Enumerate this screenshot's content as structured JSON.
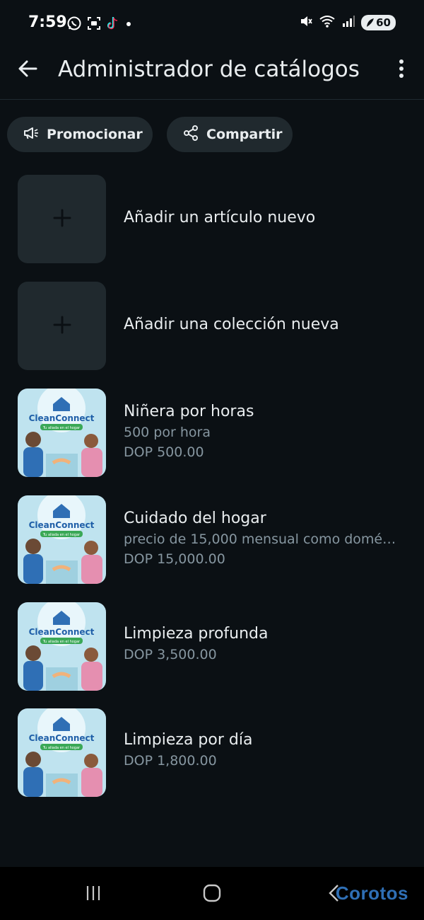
{
  "status_bar": {
    "time": "7:59",
    "battery": "60",
    "icons_left": [
      "whatsapp-icon",
      "scan-icon",
      "tiktok-icon",
      "dot-icon"
    ],
    "icons_right": [
      "mute-icon",
      "wifi-icon",
      "signal-icon",
      "battery-icon"
    ]
  },
  "header": {
    "title": "Administrador de catálogos",
    "back_icon": "arrow-left-icon",
    "menu_icon": "more-vertical-icon"
  },
  "actions": {
    "promote_label": "Promocionar",
    "promote_icon": "megaphone-icon",
    "share_label": "Compartir",
    "share_icon": "share-icon"
  },
  "add_rows": [
    {
      "label": "Añadir un artículo nuevo",
      "icon": "plus-icon"
    },
    {
      "label": "Añadir una colección nueva",
      "icon": "plus-icon"
    }
  ],
  "thumbnail": {
    "brand": "CleanConnect",
    "tagline": "Tu aliada en el hogar"
  },
  "items": [
    {
      "title": "Niñera por horas",
      "description": "500 por hora",
      "price": "DOP 500.00"
    },
    {
      "title": "Cuidado del hogar",
      "description": "precio de 15,000 mensual  como domé…",
      "price": "DOP 15,000.00"
    },
    {
      "title": "Limpieza  profunda",
      "description": "",
      "price": "DOP 3,500.00"
    },
    {
      "title": "Limpieza por día",
      "description": "",
      "price": "DOP 1,800.00"
    }
  ],
  "nav": {
    "recents_icon": "recents-icon",
    "home_icon": "home-icon",
    "back_icon": "nav-back-icon"
  },
  "watermark": "Corotos",
  "colors": {
    "background": "#0b1014",
    "surface": "#20292e",
    "text_primary": "#e9edef",
    "text_secondary": "#8696a0"
  }
}
